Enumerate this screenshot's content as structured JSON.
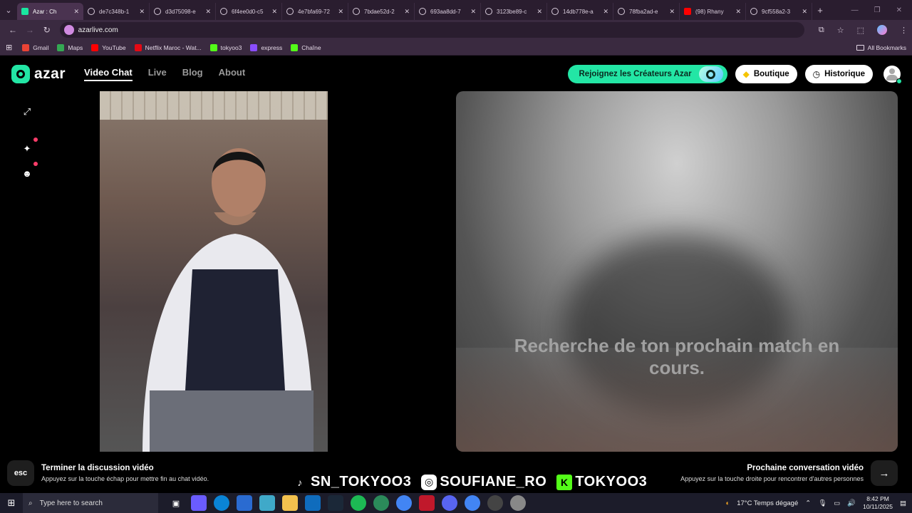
{
  "browser": {
    "tabs": [
      {
        "label": "Azar : Ch",
        "active": true,
        "favicon": "azar"
      },
      {
        "label": "de7c348b-1",
        "active": false,
        "favicon": "globe"
      },
      {
        "label": "d3d75098-e",
        "active": false,
        "favicon": "globe"
      },
      {
        "label": "6f4ee0d0-c5",
        "active": false,
        "favicon": "globe"
      },
      {
        "label": "4e7bfa69-72",
        "active": false,
        "favicon": "globe"
      },
      {
        "label": "7bdae52d-2",
        "active": false,
        "favicon": "globe"
      },
      {
        "label": "693aa8dd-7",
        "active": false,
        "favicon": "globe"
      },
      {
        "label": "3123be89-c",
        "active": false,
        "favicon": "globe"
      },
      {
        "label": "14db778e-a",
        "active": false,
        "favicon": "globe"
      },
      {
        "label": "78fba2ad-e",
        "active": false,
        "favicon": "globe"
      },
      {
        "label": "(98) Rhany",
        "active": false,
        "favicon": "youtube"
      },
      {
        "label": "9cf558a2-3",
        "active": false,
        "favicon": "globe"
      }
    ],
    "url": "azarlive.com",
    "bookmarks": [
      {
        "label": "Gmail",
        "color": "#ea4335"
      },
      {
        "label": "Maps",
        "color": "#34a853"
      },
      {
        "label": "YouTube",
        "color": "#ff0000"
      },
      {
        "label": "Netflix Maroc - Wat...",
        "color": "#e50914"
      },
      {
        "label": "tokyoo3",
        "color": "#53fc18"
      },
      {
        "label": "express",
        "color": "#8a4dff"
      },
      {
        "label": "Chaîne",
        "color": "#53fc18"
      }
    ],
    "all_bookmarks": "All Bookmarks"
  },
  "site": {
    "logo_text": "azar",
    "nav": [
      {
        "label": "Video Chat",
        "active": true
      },
      {
        "label": "Live",
        "active": false
      },
      {
        "label": "Blog",
        "active": false
      },
      {
        "label": "About",
        "active": false
      }
    ],
    "creator_button": "Rejoignez les Créateurs Azar",
    "shop_button": "Boutique",
    "history_button": "Historique",
    "accent": "#23e6a5"
  },
  "video": {
    "searching_text": "Recherche de ton prochain match en cours."
  },
  "controls": {
    "esc_key": "esc",
    "end_title": "Terminer la discussion vidéo",
    "end_hint": "Appuyez sur la touche échap pour mettre fin au chat vidéo.",
    "next_title": "Prochaine conversation vidéo",
    "next_hint": "Appuyez sur la touche droite pour rencontrer d'autres personnes",
    "arrow_key": "→"
  },
  "socials": [
    {
      "platform": "tiktok",
      "handle": "SN_TOKYOO3"
    },
    {
      "platform": "instagram",
      "handle": "SOUFIANE_RO"
    },
    {
      "platform": "kick",
      "handle": "TOKYOO3"
    }
  ],
  "taskbar": {
    "search_placeholder": "Type here to search",
    "weather": "17°C  Temps dégagé",
    "time": "8:42 PM",
    "date": "10/11/2025"
  }
}
